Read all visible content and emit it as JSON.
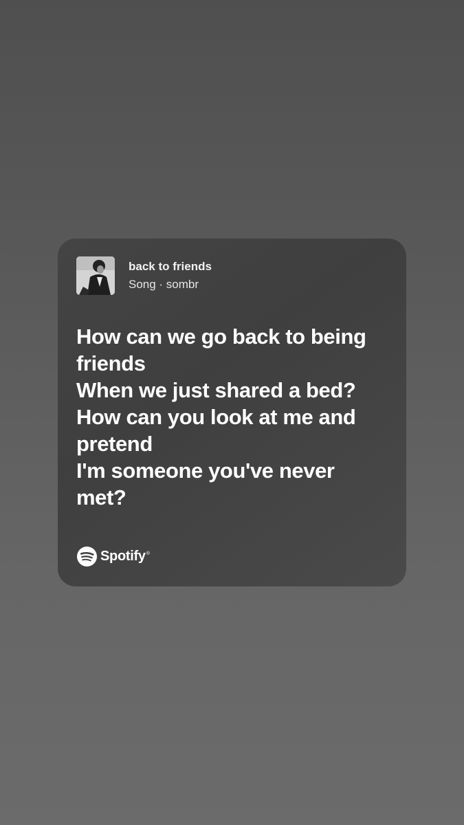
{
  "song": {
    "title": "back to friends",
    "subtitle": "Song · sombr",
    "cover_icon": "album-cover-image"
  },
  "lyrics": {
    "lines": [
      "How can we go back to being friends",
      "When we just shared a bed?",
      "How can you look at me and pretend",
      "I'm someone you've never met?"
    ]
  },
  "branding": {
    "logo_icon": "spotify-logo-icon",
    "name": "Spotify",
    "trademark": "®"
  },
  "colors": {
    "card_background": "#444444",
    "text_primary": "#ffffff"
  }
}
